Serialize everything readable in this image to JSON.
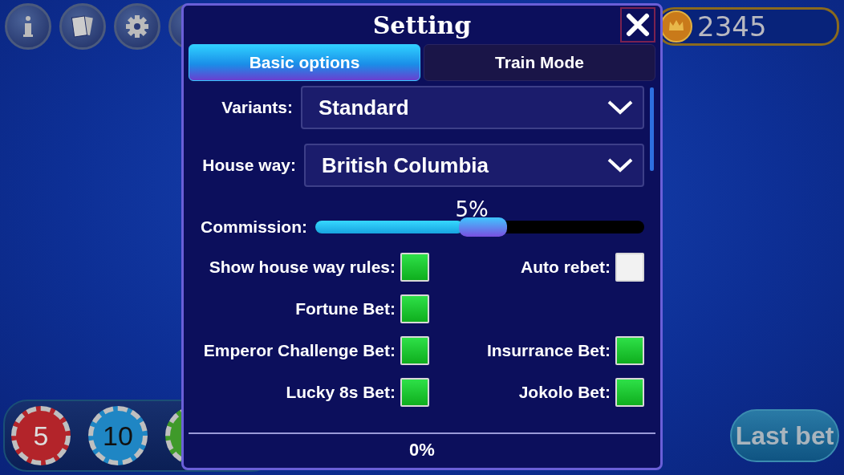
{
  "table": {
    "coins": "2345",
    "chips": [
      {
        "label": "5",
        "color": "#b3242a"
      },
      {
        "label": "10",
        "color": "#1f86c4"
      },
      {
        "color": "#3f9a2a"
      }
    ],
    "last_bet": "Last bet"
  },
  "dialog": {
    "title": "Setting",
    "tabs": [
      {
        "label": "Basic options",
        "selected": true
      },
      {
        "label": "Train Mode",
        "selected": false
      }
    ],
    "variants": {
      "label": "Variants:",
      "value": "Standard"
    },
    "house_way": {
      "label": "House way:",
      "value": "British Columbia"
    },
    "commission": {
      "label": "Commission:",
      "reading": "5%",
      "level": 0.45
    },
    "options": [
      [
        {
          "label": "Show house way rules:",
          "checked": true
        },
        {
          "label": "Auto rebet:",
          "checked": false
        }
      ],
      [
        {
          "label": "Fortune Bet:",
          "checked": true
        }
      ],
      [
        {
          "label": "Emperor Challenge Bet:",
          "checked": true
        },
        {
          "label": "Insurrance Bet:",
          "checked": true
        }
      ],
      [
        {
          "label": "Lucky 8s Bet:",
          "checked": true
        },
        {
          "label": "Jokolo Bet:",
          "checked": true
        }
      ]
    ],
    "footer": "0%"
  }
}
